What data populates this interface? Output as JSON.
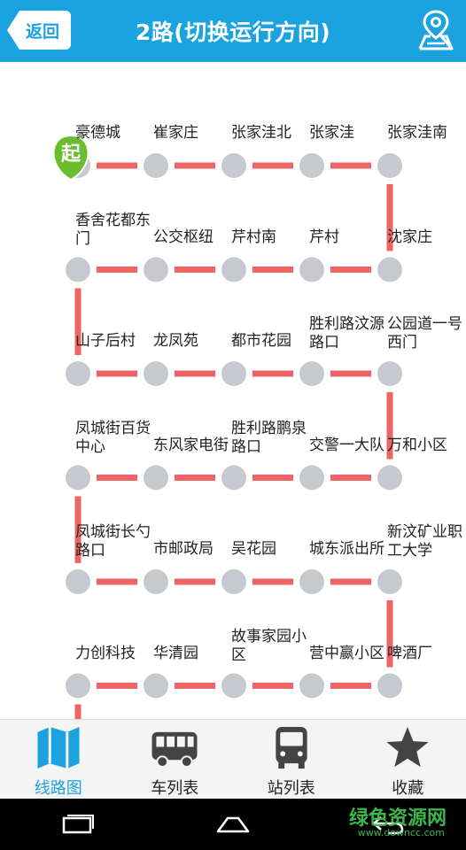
{
  "header": {
    "back_label": "返回",
    "title": "2路(切换运行方向)"
  },
  "route": {
    "start_badge": "起",
    "line_color": "#ef6464",
    "stop_color": "#c6c9cd",
    "stops": [
      "豪德城",
      "崔家庄",
      "张家洼北",
      "张家洼",
      "张家洼南",
      "沈家庄",
      "芹村",
      "芹村南",
      "公交枢纽",
      "香舍花都东门",
      "山子后村",
      "龙凤苑",
      "都市花园",
      "胜利路汶源路口",
      "公园道一号西门",
      "万和小区",
      "交警一大队",
      "胜利路鹏泉路口",
      "东风家电街",
      "凤城街百货中心",
      "凤城街长勺路口",
      "市邮政局",
      "吴花园",
      "城东派出所",
      "新汶矿业职工大学",
      "啤酒厂",
      "营中嬴小区",
      "故事家园小区",
      "华清园",
      "力创科技"
    ]
  },
  "tabs": [
    {
      "label": "线路图",
      "icon": "map-icon",
      "active": true
    },
    {
      "label": "车列表",
      "icon": "bus-icon",
      "active": false
    },
    {
      "label": "站列表",
      "icon": "bus-front-icon",
      "active": false
    },
    {
      "label": "收藏",
      "icon": "star-icon",
      "active": false
    }
  ],
  "watermark": {
    "text": "绿色资源网",
    "url_text": "www.downcc.com"
  },
  "colors": {
    "header": "#1aa3df",
    "accent": "#1aa3df",
    "start_badge": "#69bd2f"
  }
}
